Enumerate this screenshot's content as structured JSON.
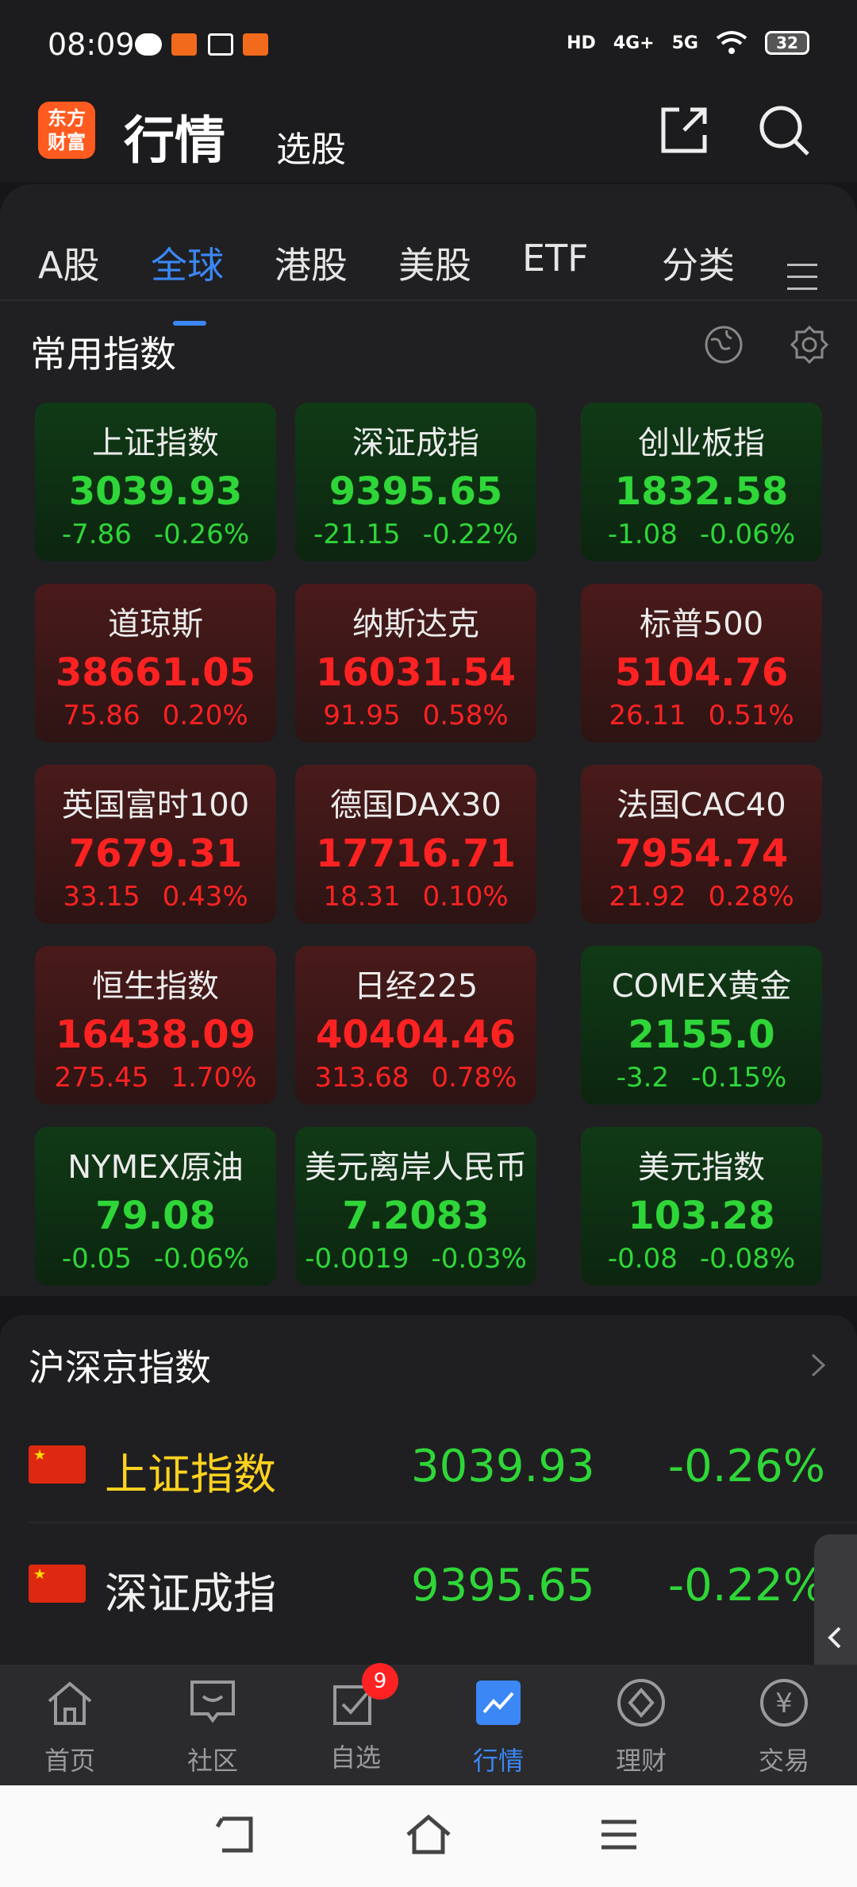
{
  "status_bar": {
    "time": "08:09",
    "hd": "HD",
    "net1": "4G+",
    "net2": "5G",
    "battery": "32"
  },
  "header": {
    "logo_line1": "东方",
    "logo_line2": "财富",
    "title": "行情",
    "subtitle": "选股"
  },
  "tabs": [
    "A股",
    "全球",
    "港股",
    "美股",
    "ETF",
    "分类"
  ],
  "active_tab": "全球",
  "common_indices": {
    "title": "常用指数",
    "cards": [
      {
        "name": "上证指数",
        "price": "3039.93",
        "change": "-7.86",
        "pct": "-0.26%",
        "dir": "down"
      },
      {
        "name": "深证成指",
        "price": "9395.65",
        "change": "-21.15",
        "pct": "-0.22%",
        "dir": "down"
      },
      {
        "name": "创业板指",
        "price": "1832.58",
        "change": "-1.08",
        "pct": "-0.06%",
        "dir": "down"
      },
      {
        "name": "道琼斯",
        "price": "38661.05",
        "change": "75.86",
        "pct": "0.20%",
        "dir": "up"
      },
      {
        "name": "纳斯达克",
        "price": "16031.54",
        "change": "91.95",
        "pct": "0.58%",
        "dir": "up"
      },
      {
        "name": "标普500",
        "price": "5104.76",
        "change": "26.11",
        "pct": "0.51%",
        "dir": "up"
      },
      {
        "name": "英国富时100",
        "price": "7679.31",
        "change": "33.15",
        "pct": "0.43%",
        "dir": "up"
      },
      {
        "name": "德国DAX30",
        "price": "17716.71",
        "change": "18.31",
        "pct": "0.10%",
        "dir": "up"
      },
      {
        "name": "法国CAC40",
        "price": "7954.74",
        "change": "21.92",
        "pct": "0.28%",
        "dir": "up"
      },
      {
        "name": "恒生指数",
        "price": "16438.09",
        "change": "275.45",
        "pct": "1.70%",
        "dir": "up"
      },
      {
        "name": "日经225",
        "price": "40404.46",
        "change": "313.68",
        "pct": "0.78%",
        "dir": "up"
      },
      {
        "name": "COMEX黄金",
        "price": "2155.0",
        "change": "-3.2",
        "pct": "-0.15%",
        "dir": "down"
      },
      {
        "name": "NYMEX原油",
        "price": "79.08",
        "change": "-0.05",
        "pct": "-0.06%",
        "dir": "down"
      },
      {
        "name": "美元离岸人民币",
        "price": "7.2083",
        "change": "-0.0019",
        "pct": "-0.03%",
        "dir": "down"
      },
      {
        "name": "美元指数",
        "price": "103.28",
        "change": "-0.08",
        "pct": "-0.08%",
        "dir": "down"
      }
    ]
  },
  "hs_indices": {
    "title": "沪深京指数",
    "rows": [
      {
        "name": "上证指数",
        "price": "3039.93",
        "pct": "-0.26%",
        "name_color": "#ffd21f"
      },
      {
        "name": "深证成指",
        "price": "9395.65",
        "pct": "-0.22%",
        "name_color": "#f0f0f0"
      }
    ]
  },
  "bottom_nav": {
    "items": [
      {
        "label": "首页",
        "icon": "home-icon"
      },
      {
        "label": "社区",
        "icon": "community-icon"
      },
      {
        "label": "自选",
        "icon": "watchlist-icon"
      },
      {
        "label": "行情",
        "icon": "market-icon"
      },
      {
        "label": "理财",
        "icon": "wealth-icon"
      },
      {
        "label": "交易",
        "icon": "trade-icon"
      }
    ],
    "badge": "9",
    "active": "行情"
  },
  "colors": {
    "accent": "#3b87f6",
    "up": "#ff2222",
    "down": "#2fd638",
    "brand": "#ff5a1f"
  }
}
